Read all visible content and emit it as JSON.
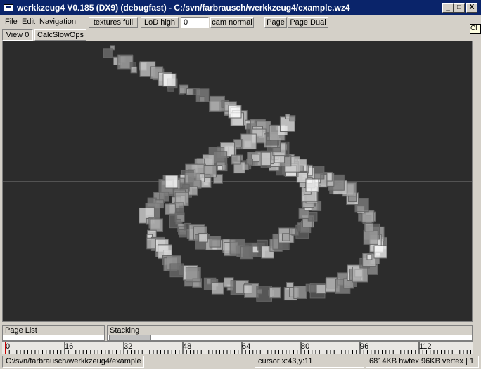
{
  "window": {
    "title": "werkkzeug4 V0.185 (DX9) (debugfast) - C:/svn/farbrausch/werkkzeug4/example.wz4",
    "buttons": {
      "minimize": "_",
      "maximize": "□",
      "close": "X"
    }
  },
  "menu": {
    "items": [
      "File",
      "Edit",
      "Navigation"
    ]
  },
  "toolbar": {
    "textures": "textures full",
    "lod": "LoD high",
    "number_value": "0",
    "cam": "cam normal",
    "page": "Page",
    "page_dual": "Page Dual"
  },
  "tooltip": {
    "text": "Cl"
  },
  "viewbar": {
    "view": "View 0",
    "calc": "CalcSlowOps"
  },
  "panels": {
    "page_list": "Page List",
    "stacking": "Stacking"
  },
  "ruler": {
    "labels": [
      "0",
      "16",
      "32",
      "48",
      "64",
      "80",
      "96",
      "112"
    ]
  },
  "statusbar": {
    "path": "C:/svn/farbrausch/werkkzeug4/example",
    "cursor": "cursor x:43,y:11",
    "memory": "6814KB hwtex  96KB vertex | 1"
  },
  "colors": {
    "titlebar": "#0a246a",
    "viewport_bg": "#2c2c2c",
    "ruler_marker": "#cc0000"
  }
}
